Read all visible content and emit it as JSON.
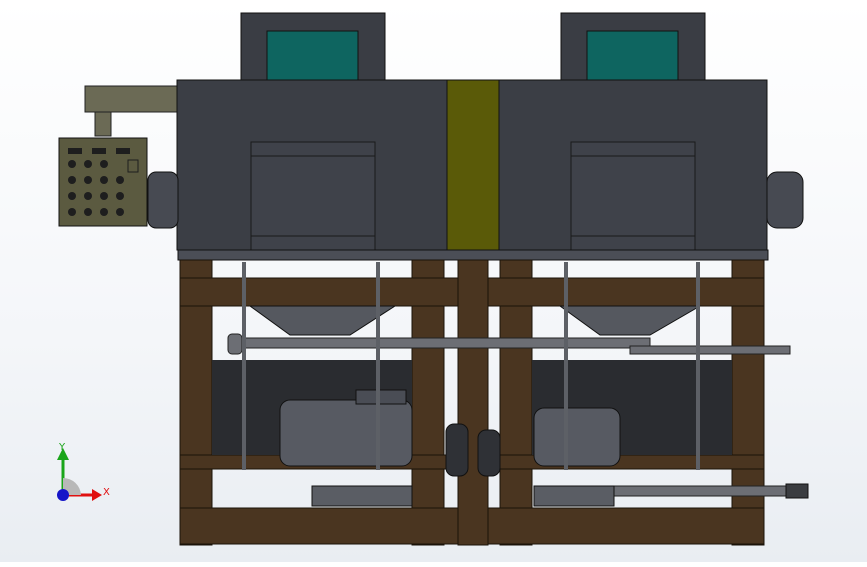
{
  "triad": {
    "x_label": "X",
    "y_label": "Y",
    "x_color": "#e01010",
    "y_color": "#1aa51a",
    "z_color": "#1515c8"
  },
  "model": {
    "body_color": "#3b3e45",
    "center_band_color": "#5a5a08",
    "window_color": "#0e6560",
    "frame_color": "#4a3520",
    "panel_color": "#5b5a40",
    "pipe_color": "#6c6e74"
  }
}
